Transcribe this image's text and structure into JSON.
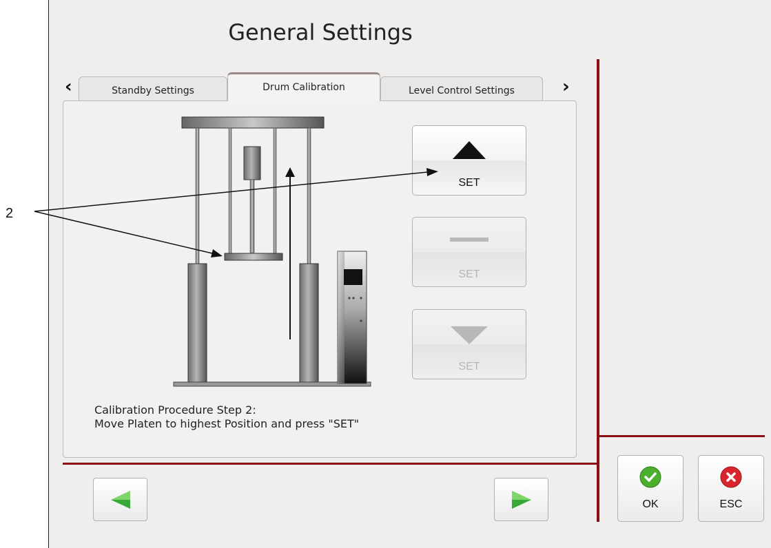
{
  "window": {
    "title": "General Settings"
  },
  "tabs": [
    {
      "label": "Standby Settings"
    },
    {
      "label": "Drum Calibration",
      "active": true
    },
    {
      "label": "Level Control Settings"
    }
  ],
  "tab_nav": {
    "prev": "‹",
    "next": "›"
  },
  "controls": {
    "up": {
      "label": "SET",
      "enabled": true
    },
    "stop": {
      "label": "SET",
      "enabled": false
    },
    "down": {
      "label": "SET",
      "enabled": false
    }
  },
  "instructions": {
    "line1": "Calibration Procedure Step 2:",
    "line2": "Move Platen to highest Position and press \"SET\""
  },
  "footer": {
    "ok_label": "OK",
    "esc_label": "ESC"
  },
  "callout": {
    "label": "2"
  },
  "colors": {
    "accent_red": "#8b0f12",
    "nav_green": "#3aa53a",
    "ok_green": "#4caf2e",
    "esc_red": "#d9262c"
  },
  "icons": {
    "up": "triangle-up-icon",
    "stop": "dash-icon",
    "down": "triangle-down-icon",
    "back": "green-left-arrow-icon",
    "forward": "green-right-arrow-icon",
    "ok": "check-circle-icon",
    "esc": "x-circle-icon"
  }
}
